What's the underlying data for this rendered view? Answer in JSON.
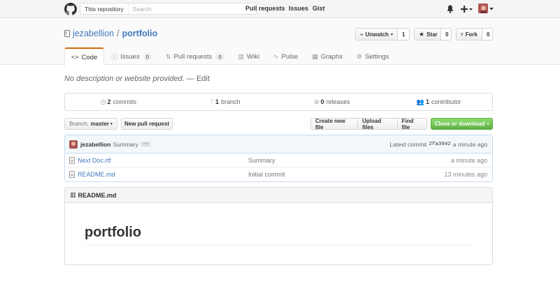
{
  "header": {
    "search_scope": "This repository",
    "search_placeholder": "Search",
    "nav": [
      "Pull requests",
      "Issues",
      "Gist"
    ],
    "colors": {
      "background": "#f5f5f5"
    }
  },
  "repo": {
    "owner": "jezabellion",
    "separator": "/",
    "name": "portfolio",
    "watch_label": "Unwatch",
    "watch_count": "1",
    "star_label": "Star",
    "star_count": "0",
    "fork_label": "Fork",
    "fork_count": "0"
  },
  "tabs": [
    {
      "label": "Code",
      "icon": "code-icon",
      "selected": true
    },
    {
      "label": "Issues",
      "icon": "issue-icon",
      "count": "0"
    },
    {
      "label": "Pull requests",
      "icon": "pull-request-icon",
      "count": "0"
    },
    {
      "label": "Wiki",
      "icon": "book-icon"
    },
    {
      "label": "Pulse",
      "icon": "pulse-icon"
    },
    {
      "label": "Graphs",
      "icon": "graph-icon"
    },
    {
      "label": "Settings",
      "icon": "gear-icon"
    }
  ],
  "description": {
    "text": "No description or website provided.",
    "dash": "—",
    "edit": "Edit"
  },
  "summary": {
    "commits_count": "2",
    "commits_label": "commits",
    "branch_count": "1",
    "branch_label": "branch",
    "releases_count": "0",
    "releases_label": "releases",
    "contributors_count": "1",
    "contributors_label": "contributor"
  },
  "file_nav": {
    "branch_prefix": "Branch:",
    "branch_name": "master",
    "new_pr": "New pull request",
    "create_file": "Create new file",
    "upload_files": "Upload files",
    "find_file": "Find file",
    "clone": "Clone or download"
  },
  "latest_commit": {
    "author": "jezabellion",
    "message": "Summary",
    "ellipsis": "…",
    "prefix": "Latest commit",
    "sha": "2fa3942",
    "age": "a minute ago"
  },
  "files": [
    {
      "name": "Next Doc.rtf",
      "message": "Summary",
      "age": "a minute ago"
    },
    {
      "name": "README.md",
      "message": "Initial commit",
      "age": "13 minutes ago"
    }
  ],
  "readme": {
    "header": "README.md",
    "title": "portfolio"
  },
  "colors": {
    "link": "#4078c0",
    "tab_accent": "#d26911",
    "clone_green": "#60b044"
  }
}
